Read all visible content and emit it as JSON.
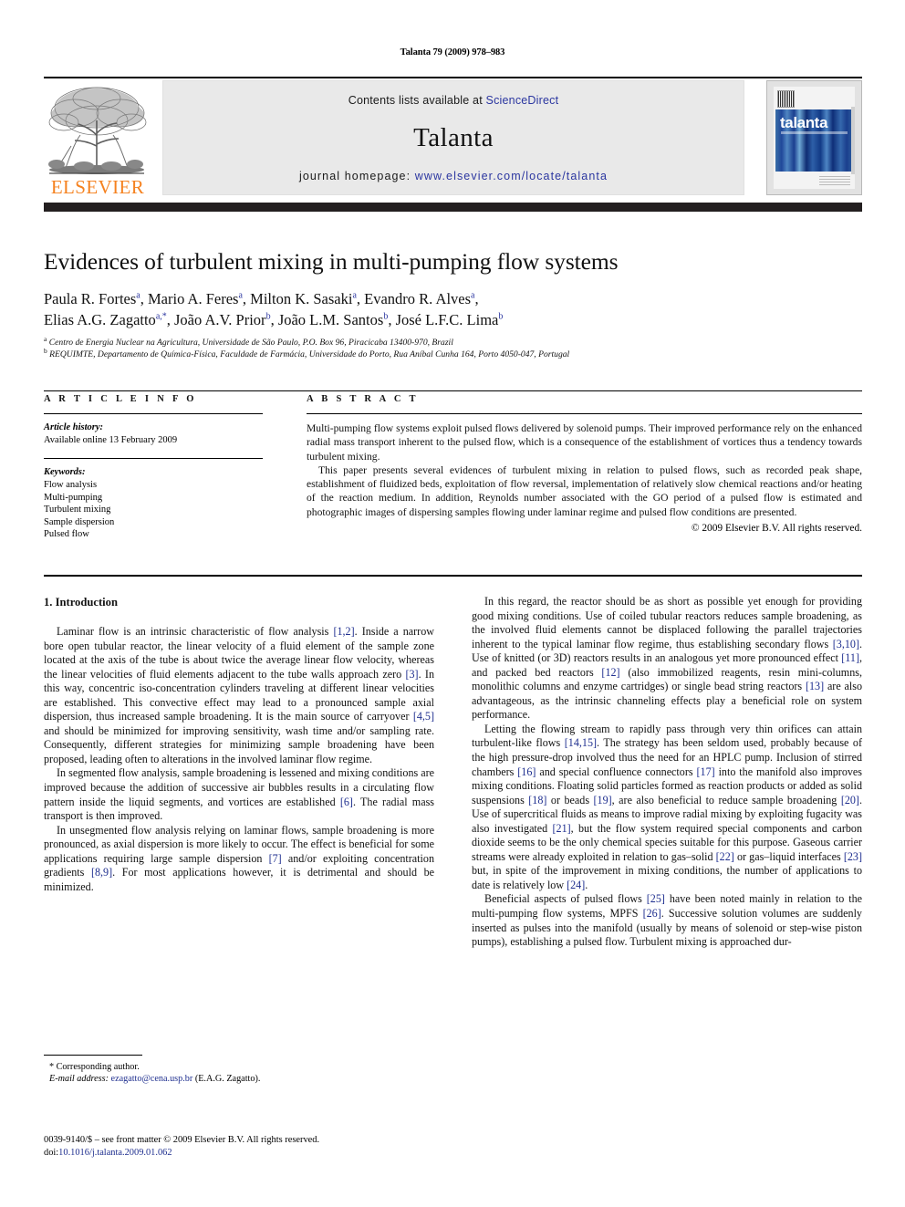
{
  "running_head": "Talanta 79 (2009) 978–983",
  "masthead": {
    "publisher_wordmark": "ELSEVIER",
    "contents_prefix": "Contents lists available at ",
    "contents_link": "ScienceDirect",
    "journal_name": "Talanta",
    "homepage_prefix": "journal homepage: ",
    "homepage_url": "www.elsevier.com/locate/talanta",
    "cover_title": "talanta",
    "link_color": "#2b36a0",
    "elsevier_orange": "#f58220",
    "band_color": "#e9e9e9",
    "bar_color": "#231f20"
  },
  "article": {
    "title": "Evidences of turbulent mixing in multi-pumping flow systems",
    "authors_line_1": "Paula R. Fortes",
    "authors_html_1": "Paula R. Fortes<sup>a</sup>, Mario A. Feres<sup>a</sup>, Milton K. Sasaki<sup>a</sup>, Evandro R. Alves<sup>a</sup>,",
    "authors_html_2": "Elias A.G. Zagatto<sup>a,*</sup>, João A.V. Prior<sup>b</sup>, João L.M. Santos<sup>b</sup>, José L.F.C. Lima<sup>b</sup>",
    "affiliation_a": "Centro de Energia Nuclear na Agricultura, Universidade de São Paulo, P.O. Box 96, Piracicaba 13400-970, Brazil",
    "affiliation_b": "REQUIMTE, Departamento de Química-Física, Faculdade de Farmácia, Universidade do Porto, Rua Aníbal Cunha 164, Porto 4050-047, Portugal"
  },
  "article_info": {
    "heading": "A R T I C L E    I N F O",
    "history_label": "Article history:",
    "history_value": "Available online 13 February 2009",
    "keywords_label": "Keywords:",
    "keywords": [
      "Flow analysis",
      "Multi-pumping",
      "Turbulent mixing",
      "Sample dispersion",
      "Pulsed flow"
    ]
  },
  "abstract": {
    "heading": "A B S T R A C T",
    "paragraph_1": "Multi-pumping flow systems exploit pulsed flows delivered by solenoid pumps. Their improved performance rely on the enhanced radial mass transport inherent to the pulsed flow, which is a consequence of the establishment of vortices thus a tendency towards turbulent mixing.",
    "paragraph_2": "This paper presents several evidences of turbulent mixing in relation to pulsed flows, such as recorded peak shape, establishment of fluidized beds, exploitation of flow reversal, implementation of relatively slow chemical reactions and/or heating of the reaction medium. In addition, Reynolds number associated with the GO period of a pulsed flow is estimated and photographic images of dispersing samples flowing under laminar regime and pulsed flow conditions are presented.",
    "copyright": "© 2009 Elsevier B.V. All rights reserved."
  },
  "body": {
    "section_heading": "1.  Introduction",
    "left_paragraphs": [
      "Laminar flow is an intrinsic characteristic of flow analysis [1,2]. Inside a narrow bore open tubular reactor, the linear velocity of a fluid element of the sample zone located at the axis of the tube is about twice the average linear flow velocity, whereas the linear velocities of fluid elements adjacent to the tube walls approach zero [3]. In this way, concentric iso-concentration cylinders traveling at different linear velocities are established. This convective effect may lead to a pronounced sample axial dispersion, thus increased sample broadening. It is the main source of carryover [4,5] and should be minimized for improving sensitivity, wash time and/or sampling rate. Consequently, different strategies for minimizing sample broadening have been proposed, leading often to alterations in the involved laminar flow regime.",
      "In segmented flow analysis, sample broadening is lessened and mixing conditions are improved because the addition of successive air bubbles results in a circulating flow pattern inside the liquid segments, and vortices are established [6]. The radial mass transport is then improved.",
      "In unsegmented flow analysis relying on laminar flows, sample broadening is more pronounced, as axial dispersion is more likely to occur. The effect is beneficial for some applications requiring large sample dispersion [7] and/or exploiting concentration gradients [8,9]. For most applications however, it is detrimental and should be minimized."
    ],
    "right_paragraphs": [
      "In this regard, the reactor should be as short as possible yet enough for providing good mixing conditions. Use of coiled tubular reactors reduces sample broadening, as the involved fluid elements cannot be displaced following the parallel trajectories inherent to the typical laminar flow regime, thus establishing secondary flows [3,10]. Use of knitted (or 3D) reactors results in an analogous yet more pronounced effect [11], and packed bed reactors [12] (also immobilized reagents, resin mini-columns, monolithic columns and enzyme cartridges) or single bead string reactors [13] are also advantageous, as the intrinsic channeling effects play a beneficial role on system performance.",
      "Letting the flowing stream to rapidly pass through very thin orifices can attain turbulent-like flows [14,15]. The strategy has been seldom used, probably because of the high pressure-drop involved thus the need for an HPLC pump. Inclusion of stirred chambers [16] and special confluence connectors [17] into the manifold also improves mixing conditions. Floating solid particles formed as reaction products or added as solid suspensions [18] or beads [19], are also beneficial to reduce sample broadening [20]. Use of supercritical fluids as means to improve radial mixing by exploiting fugacity was also investigated [21], but the flow system required special components and carbon dioxide seems to be the only chemical species suitable for this purpose. Gaseous carrier streams were already exploited in relation to gas–solid [22] or gas–liquid interfaces [23] but, in spite of the improvement in mixing conditions, the number of applications to date is relatively low [24].",
      "Beneficial aspects of pulsed flows [25] have been noted mainly in relation to the multi-pumping flow systems, MPFS [26]. Successive solution volumes are suddenly inserted as pulses into the manifold (usually by means of solenoid or step-wise piston pumps), establishing a pulsed flow. Turbulent mixing is approached dur-"
    ]
  },
  "footnotes": {
    "corresponding_marker": "*",
    "corresponding_text": "Corresponding author.",
    "email_label": "E-mail address:",
    "email_link": "ezagatto@cena.usp.br",
    "email_suffix": "(E.A.G. Zagatto)."
  },
  "frontmatter": {
    "line1": "0039-9140/$ – see front matter © 2009 Elsevier B.V. All rights reserved.",
    "doi_label": "doi:",
    "doi_value": "10.1016/j.talanta.2009.01.062"
  }
}
